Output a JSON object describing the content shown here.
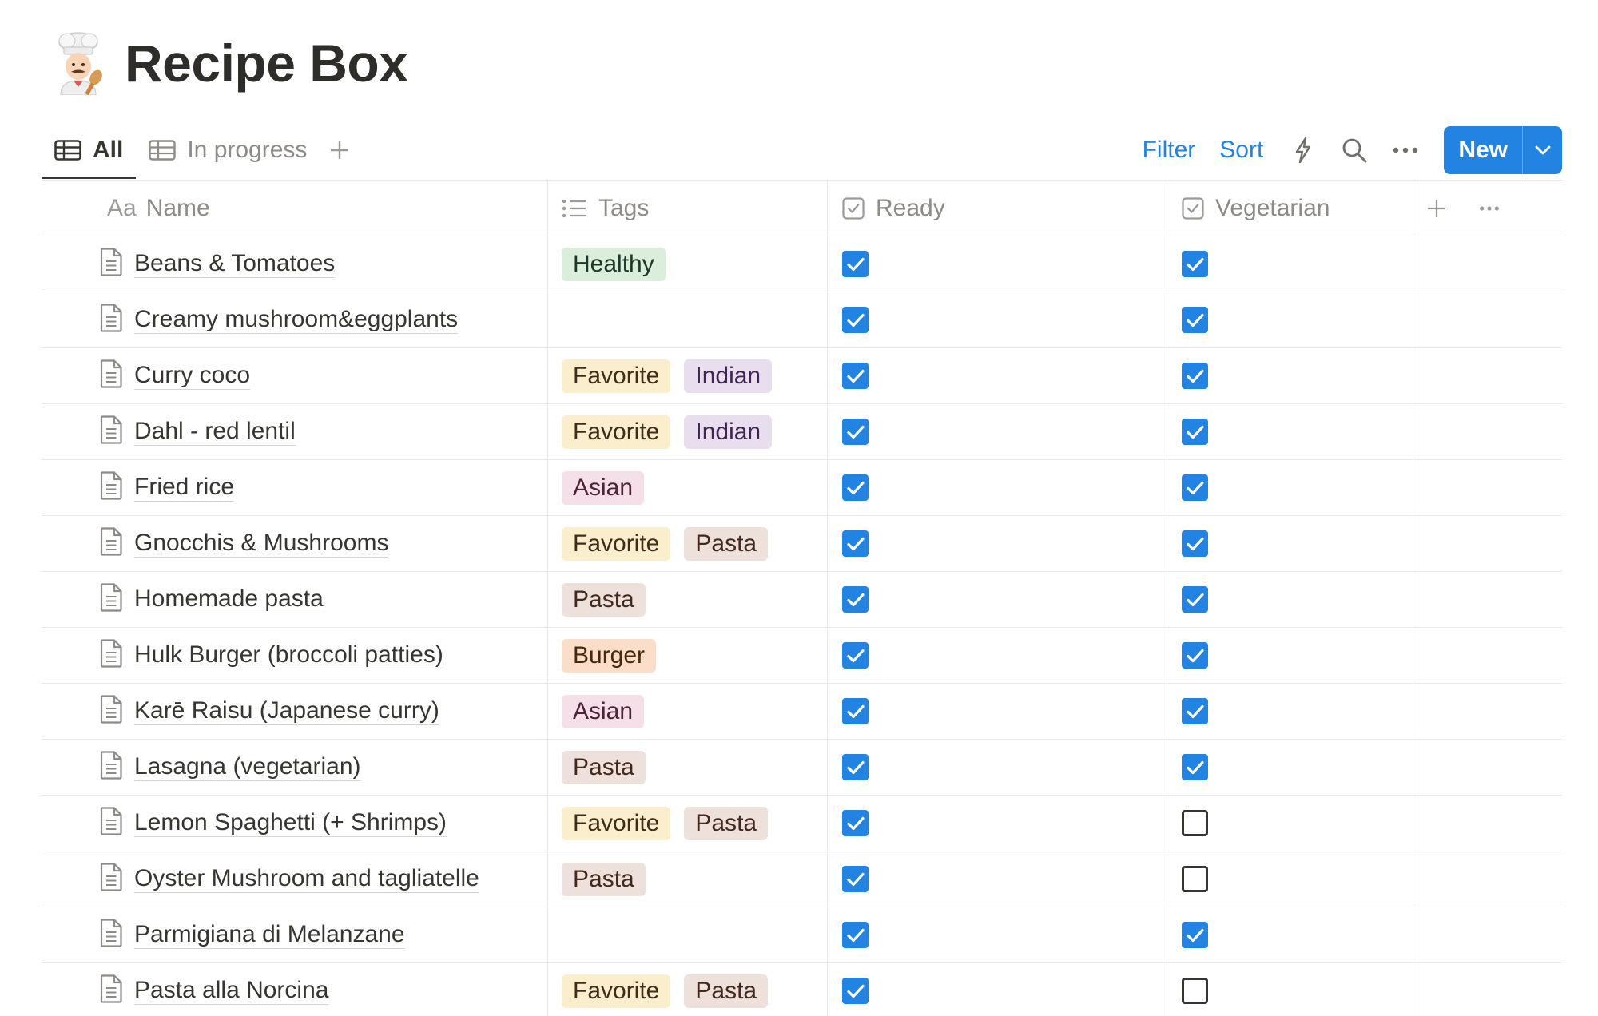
{
  "page": {
    "title": "Recipe Box",
    "icon": "chef-emoji-icon"
  },
  "tabs": [
    {
      "label": "All",
      "icon": "table-icon",
      "active": true
    },
    {
      "label": "In progress",
      "icon": "table-icon",
      "active": false
    }
  ],
  "toolbar": {
    "filter": "Filter",
    "sort": "Sort",
    "new_label": "New"
  },
  "columns": {
    "name": {
      "prefix": "Aa",
      "label": "Name"
    },
    "tags": {
      "label": "Tags",
      "icon": "list-icon"
    },
    "ready": {
      "label": "Ready",
      "icon": "checkbox-icon"
    },
    "vegetarian": {
      "label": "Vegetarian",
      "icon": "checkbox-icon"
    }
  },
  "tag_colors": {
    "Healthy": {
      "bg": "#dbeddb",
      "fg": "#1c3829"
    },
    "Favorite": {
      "bg": "#fbeecc",
      "fg": "#402c1b"
    },
    "Indian": {
      "bg": "#e8deee",
      "fg": "#412454"
    },
    "Asian": {
      "bg": "#f5e0e9",
      "fg": "#4c2337"
    },
    "Pasta": {
      "bg": "#eee0da",
      "fg": "#442a1e"
    },
    "Burger": {
      "bg": "#fadec9",
      "fg": "#49290e"
    }
  },
  "rows": [
    {
      "name": "Beans & Tomatoes",
      "tags": [
        "Healthy"
      ],
      "ready": true,
      "vegetarian": true
    },
    {
      "name": "Creamy mushroom&eggplants",
      "tags": [],
      "ready": true,
      "vegetarian": true
    },
    {
      "name": "Curry coco",
      "tags": [
        "Favorite",
        "Indian"
      ],
      "ready": true,
      "vegetarian": true
    },
    {
      "name": "Dahl - red lentil",
      "tags": [
        "Favorite",
        "Indian"
      ],
      "ready": true,
      "vegetarian": true
    },
    {
      "name": "Fried rice",
      "tags": [
        "Asian"
      ],
      "ready": true,
      "vegetarian": true
    },
    {
      "name": "Gnocchis & Mushrooms",
      "tags": [
        "Favorite",
        "Pasta"
      ],
      "ready": true,
      "vegetarian": true
    },
    {
      "name": "Homemade pasta",
      "tags": [
        "Pasta"
      ],
      "ready": true,
      "vegetarian": true
    },
    {
      "name": "Hulk Burger (broccoli patties)",
      "tags": [
        "Burger"
      ],
      "ready": true,
      "vegetarian": true
    },
    {
      "name": "Karē Raisu (Japanese curry)",
      "tags": [
        "Asian"
      ],
      "ready": true,
      "vegetarian": true
    },
    {
      "name": "Lasagna (vegetarian)",
      "tags": [
        "Pasta"
      ],
      "ready": true,
      "vegetarian": true
    },
    {
      "name": "Lemon Spaghetti (+ Shrimps)",
      "tags": [
        "Favorite",
        "Pasta"
      ],
      "ready": true,
      "vegetarian": false
    },
    {
      "name": "Oyster Mushroom and tagliatelle",
      "tags": [
        "Pasta"
      ],
      "ready": true,
      "vegetarian": false
    },
    {
      "name": "Parmigiana di Melanzane",
      "tags": [],
      "ready": true,
      "vegetarian": true
    },
    {
      "name": "Pasta alla Norcina",
      "tags": [
        "Favorite",
        "Pasta"
      ],
      "ready": true,
      "vegetarian": false
    }
  ]
}
